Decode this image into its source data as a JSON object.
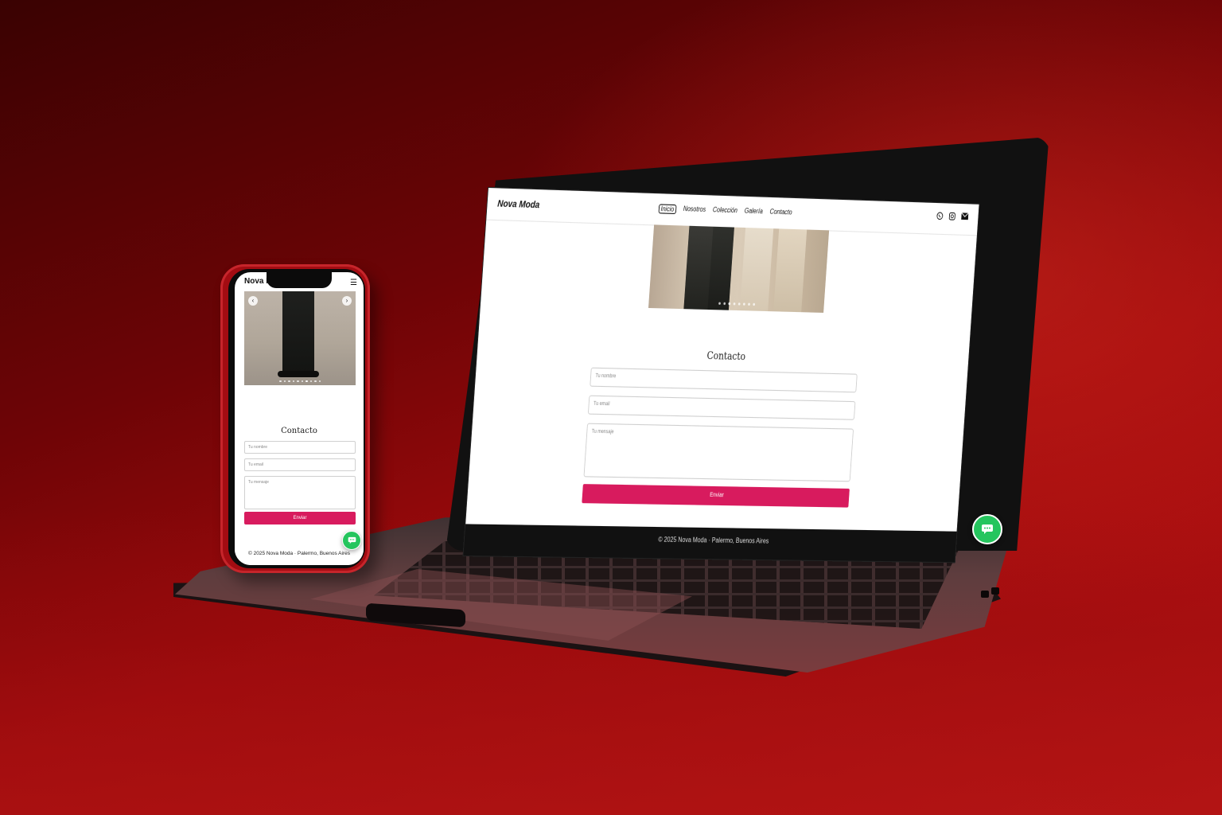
{
  "site": {
    "brand": "Nova Moda",
    "nav": [
      "Inicio",
      "Nosotros",
      "Colección",
      "Galería",
      "Contacto"
    ],
    "active_nav": "Inicio",
    "social_icons": [
      "whatsapp-icon",
      "instagram-icon",
      "mail-icon"
    ],
    "contact_title": "Contacto",
    "name_placeholder": "Tu nombre",
    "email_placeholder": "Tu email",
    "message_placeholder": "Tu mensaje",
    "submit_label": "Enviar",
    "footer": "© 2025 Nova Moda · Palermo, Buenos Aires",
    "accent_color": "#d81b5e",
    "chat_color": "#25c55e"
  },
  "laptop": {
    "carousel_dots": 8,
    "active_dot": 2
  },
  "phone": {
    "carousel_dots": 10,
    "active_dot": 6
  }
}
